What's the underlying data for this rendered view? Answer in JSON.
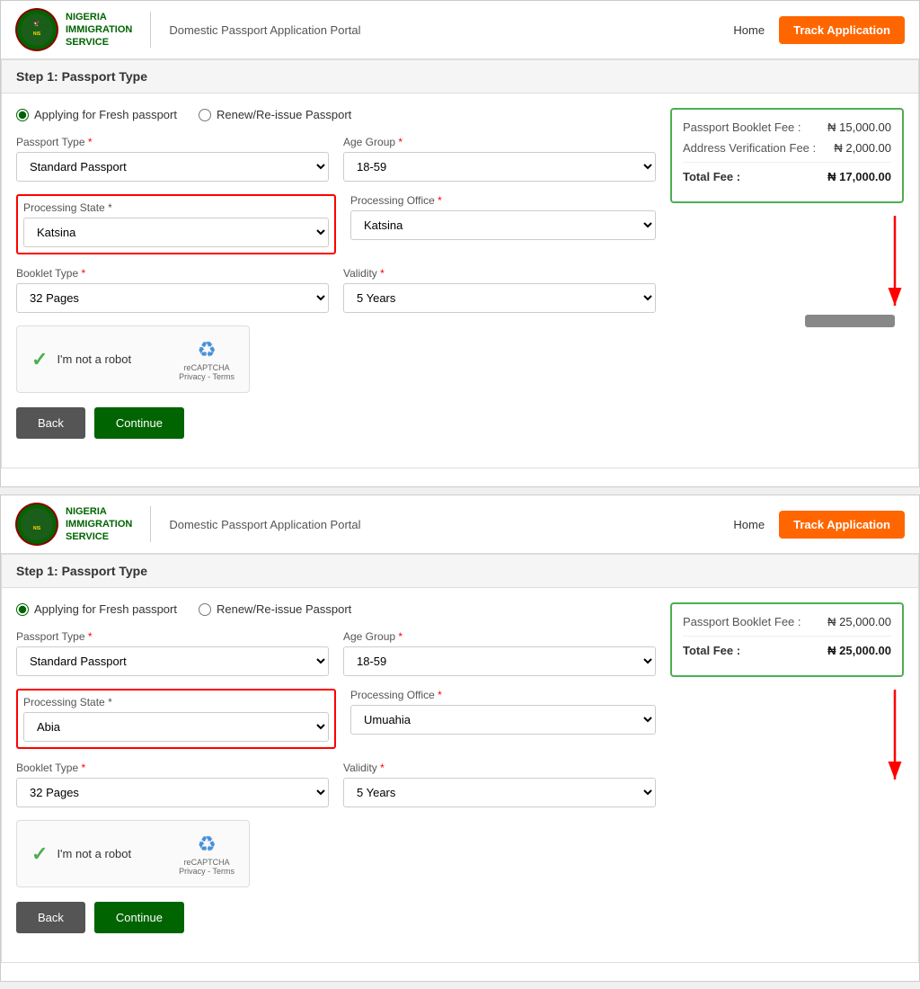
{
  "header": {
    "logo_title": "NIGERIA\nIMMIGRATION\nSERVICE",
    "portal_title": "Domestic Passport Application Portal",
    "home_label": "Home",
    "track_btn_label": "Track Application"
  },
  "screenshots": [
    {
      "step_title": "Step 1: Passport Type",
      "radio_options": [
        {
          "id": "fresh1",
          "label": "Applying for Fresh passport",
          "checked": true
        },
        {
          "id": "renew1",
          "label": "Renew/Re-issue Passport",
          "checked": false
        }
      ],
      "fields": {
        "passport_type_label": "Passport Type",
        "passport_type_value": "Standard Passport",
        "age_group_label": "Age Group",
        "age_group_value": "18-59",
        "processing_state_label": "Processing State",
        "processing_state_value": "Katsina",
        "processing_office_label": "Processing Office",
        "processing_office_value": "Katsina",
        "booklet_type_label": "Booklet Type",
        "booklet_type_value": "32 Pages",
        "validity_label": "Validity",
        "validity_value": "5 Years"
      },
      "captcha": {
        "robot_label": "I'm not a robot",
        "brand": "reCAPTCHA",
        "sub": "Privacy - Terms"
      },
      "buttons": {
        "back": "Back",
        "continue": "Continue"
      },
      "fees": {
        "booklet_fee_label": "Passport Booklet Fee :",
        "booklet_fee_value": "₦ 15,000.00",
        "address_fee_label": "Address Verification Fee :",
        "address_fee_value": "₦ 2,000.00",
        "total_label": "Total Fee :",
        "total_value": "₦ 17,000.00"
      }
    },
    {
      "step_title": "Step 1: Passport Type",
      "radio_options": [
        {
          "id": "fresh2",
          "label": "Applying for Fresh passport",
          "checked": true
        },
        {
          "id": "renew2",
          "label": "Renew/Re-issue Passport",
          "checked": false
        }
      ],
      "fields": {
        "passport_type_label": "Passport Type",
        "passport_type_value": "Standard Passport",
        "age_group_label": "Age Group",
        "age_group_value": "18-59",
        "processing_state_label": "Processing State",
        "processing_state_value": "Abia",
        "processing_office_label": "Processing Office",
        "processing_office_value": "Umuahia",
        "booklet_type_label": "Booklet Type",
        "booklet_type_value": "32 Pages",
        "validity_label": "Validity",
        "validity_value": "5 Years"
      },
      "captcha": {
        "robot_label": "I'm not a robot",
        "brand": "reCAPTCHA",
        "sub": "Privacy - Terms"
      },
      "buttons": {
        "back": "Back",
        "continue": "Continue"
      },
      "fees": {
        "booklet_fee_label": "Passport Booklet Fee :",
        "booklet_fee_value": "₦ 25,000.00",
        "address_fee_label": null,
        "address_fee_value": null,
        "total_label": "Total Fee :",
        "total_value": "₦ 25,000.00"
      }
    }
  ]
}
